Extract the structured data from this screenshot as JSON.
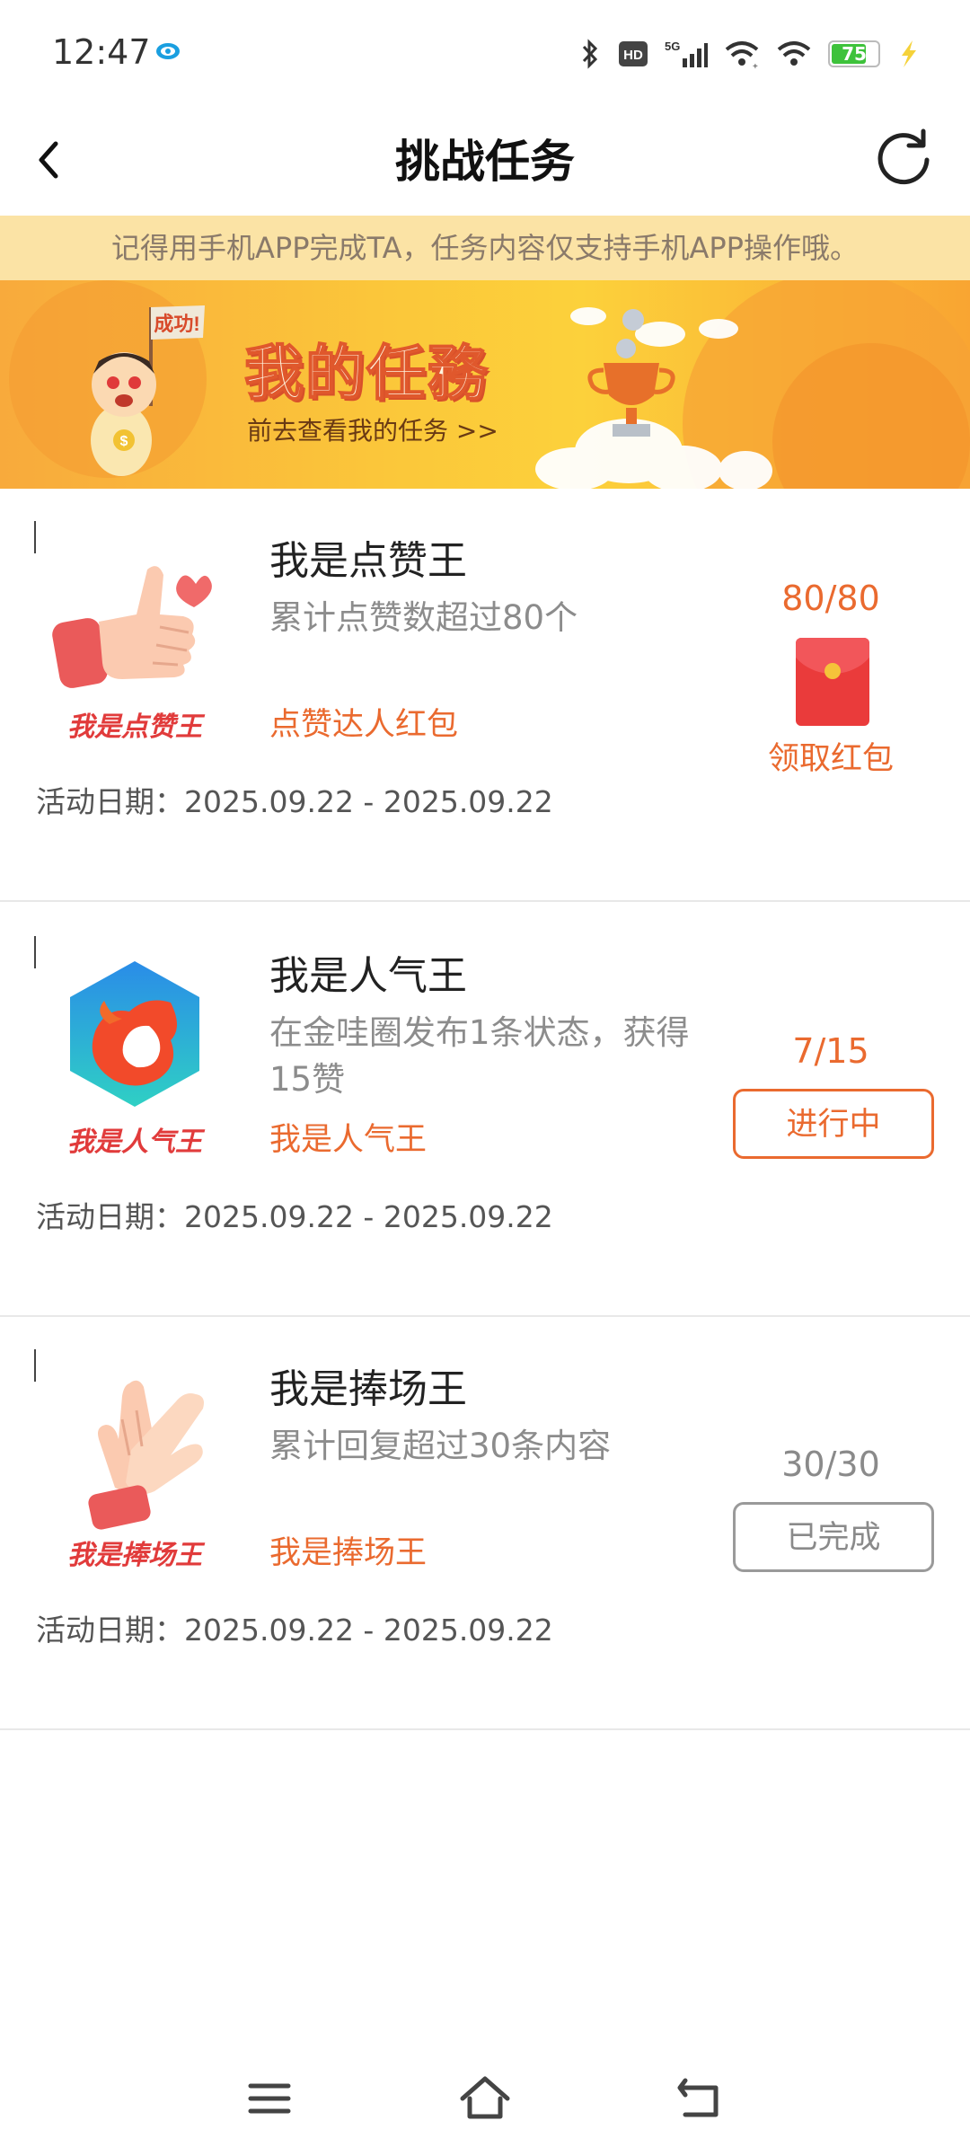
{
  "status_bar": {
    "time": "12:47",
    "battery": "75",
    "battery_level": 0.75,
    "icons": [
      "bluetooth-icon",
      "hd-icon",
      "5g-signal-icon",
      "wifi-signal-icon",
      "wifi-icon",
      "battery-icon",
      "charging-icon"
    ]
  },
  "header": {
    "title": "挑战任务",
    "back_icon": "back-arrow-icon",
    "refresh_icon": "refresh-icon"
  },
  "notice": "记得用手机APP完成TA，任务内容仅支持手机APP操作哦。",
  "banner": {
    "flag_text": "成功!",
    "title": "我的任務",
    "subtitle": "前去查看我的任务 >>"
  },
  "tasks": [
    {
      "image_label": "我是点赞王",
      "title": "我是点赞王",
      "desc": "累计点赞数超过80个",
      "reward": "点赞达人红包",
      "date": "活动日期：2025.09.22 - 2025.09.22",
      "progress": "80/80",
      "action": "领取红包"
    },
    {
      "image_label": "我是人气王",
      "title": "我是人气王",
      "desc": "在金哇圈发布1条状态，获得15赞",
      "reward": "我是人气王",
      "date": "活动日期：2025.09.22 - 2025.09.22",
      "progress": "7/15",
      "action": "进行中"
    },
    {
      "image_label": "我是捧场王",
      "title": "我是捧场王",
      "desc": "累计回复超过30条内容",
      "reward": "我是捧场王",
      "date": "活动日期：2025.09.22 - 2025.09.22",
      "progress": "30/30",
      "action": "已完成"
    }
  ],
  "colors": {
    "accent": "#ea6a2f",
    "notice_bg": "#fbe3a5",
    "banner_bg": "#fcc63a",
    "done_gray": "#8a8a8a"
  },
  "nav_bar": {
    "icons": [
      "menu-icon",
      "home-icon",
      "back-nav-icon"
    ]
  }
}
